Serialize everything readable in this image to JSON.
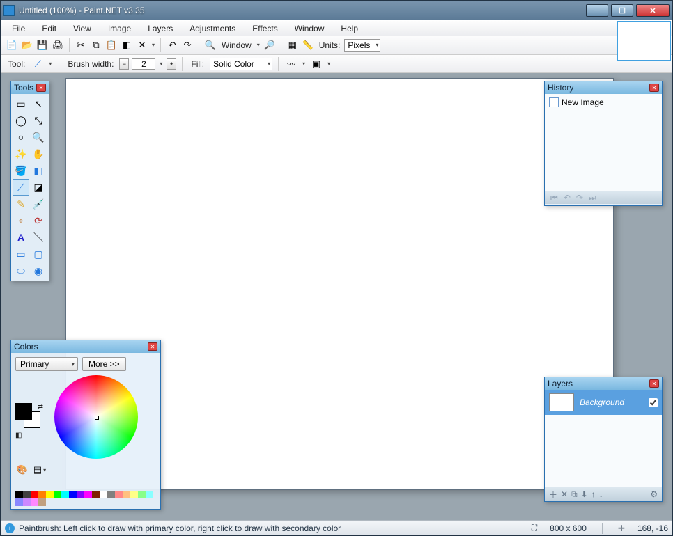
{
  "window": {
    "title": "Untitled (100%) - Paint.NET v3.35"
  },
  "menu": {
    "items": [
      "File",
      "Edit",
      "View",
      "Image",
      "Layers",
      "Adjustments",
      "Effects",
      "Window",
      "Help"
    ]
  },
  "toolbar1": {
    "window_label": "Window",
    "units_label": "Units:",
    "units_value": "Pixels"
  },
  "toolbar2": {
    "tool_label": "Tool:",
    "brush_label": "Brush width:",
    "brush_value": "2",
    "fill_label": "Fill:",
    "fill_value": "Solid Color"
  },
  "panels": {
    "tools": {
      "title": "Tools"
    },
    "history": {
      "title": "History",
      "items": [
        {
          "label": "New Image"
        }
      ]
    },
    "colors": {
      "title": "Colors",
      "selector": "Primary",
      "more": "More >>",
      "palette": [
        "#000",
        "#404040",
        "#f00",
        "#ff8000",
        "#ff0",
        "#0f0",
        "#0ff",
        "#00f",
        "#80f",
        "#f0f",
        "#802000",
        "#fff",
        "#808080",
        "#f88",
        "#ffc080",
        "#ff8",
        "#8f8",
        "#8ff",
        "#88f",
        "#c8f",
        "#f8f",
        "#c0a080"
      ]
    },
    "layers": {
      "title": "Layers",
      "items": [
        {
          "name": "Background",
          "visible": true
        }
      ]
    }
  },
  "status": {
    "hint": "Paintbrush: Left click to draw with primary color, right click to draw with secondary color",
    "size": "800 x 600",
    "coords": "168, -16"
  }
}
